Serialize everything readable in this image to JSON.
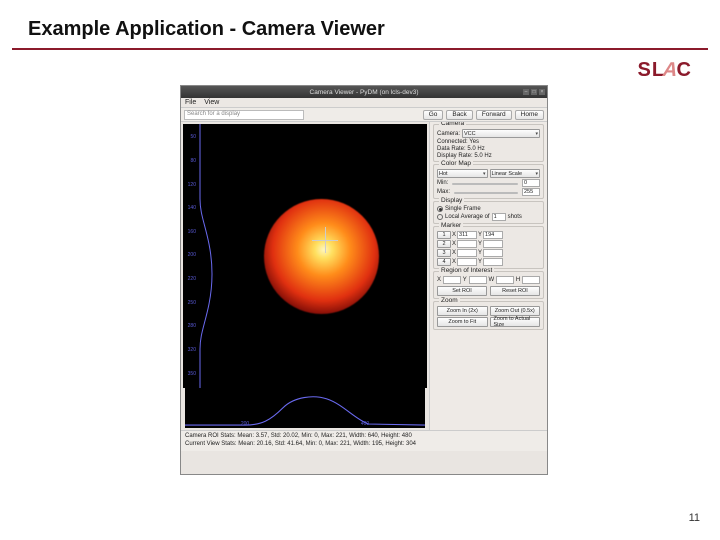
{
  "slide": {
    "title": "Example Application - Camera Viewer",
    "page": "11",
    "logo": "SLAC"
  },
  "window": {
    "title": "Camera Viewer - PyDM (on lcls-dev3)"
  },
  "menu": {
    "file": "File",
    "view": "View"
  },
  "toolbar": {
    "search_placeholder": "Search for a display",
    "go": "Go",
    "back": "Back",
    "forward": "Forward",
    "home": "Home"
  },
  "yaxis": [
    "50",
    "80",
    "120",
    "140",
    "160",
    "200",
    "220",
    "250",
    "280",
    "320",
    "350"
  ],
  "xaxis": [
    "200",
    "400"
  ],
  "camera": {
    "title": "Camera",
    "name_label": "Camera:",
    "name_value": "VCC",
    "connected": "Connected: Yes",
    "data_rate": "Data Rate: 5.0 Hz",
    "display_rate": "Display Rate: 5.0 Hz"
  },
  "colormap": {
    "title": "Color Map",
    "map_value": "Hot",
    "scale_value": "Linear Scale",
    "min_label": "Min:",
    "min_value": "0",
    "max_label": "Max:",
    "max_value": "255"
  },
  "display": {
    "title": "Display",
    "single": "Single Frame",
    "avg_prefix": "Local Average of",
    "avg_value": "1",
    "avg_suffix": "shots"
  },
  "marker": {
    "title": "Marker",
    "rows": [
      {
        "n": "1",
        "x": "311",
        "y": "194"
      },
      {
        "n": "2",
        "x": "",
        "y": ""
      },
      {
        "n": "3",
        "x": "",
        "y": ""
      },
      {
        "n": "4",
        "x": "",
        "y": ""
      }
    ],
    "x_label": "X",
    "y_label": "Y"
  },
  "roi": {
    "title": "Region of Interest",
    "x": "X",
    "y": "Y",
    "w": "W",
    "h": "H",
    "set": "Set ROI",
    "reset": "Reset ROI"
  },
  "zoom": {
    "title": "Zoom",
    "in": "Zoom In (2x)",
    "out": "Zoom Out (0.5x)",
    "fit": "Zoom to Fit",
    "actual": "Zoom to Actual Size"
  },
  "stats": {
    "l1": "Camera ROI Stats:  Mean: 3.57, Std: 20.02, Min: 0, Max: 221, Width: 640, Height: 480",
    "l2": "Current View Stats:  Mean: 20.16, Std: 41.64, Min: 0, Max: 221, Width: 195, Height: 304"
  }
}
